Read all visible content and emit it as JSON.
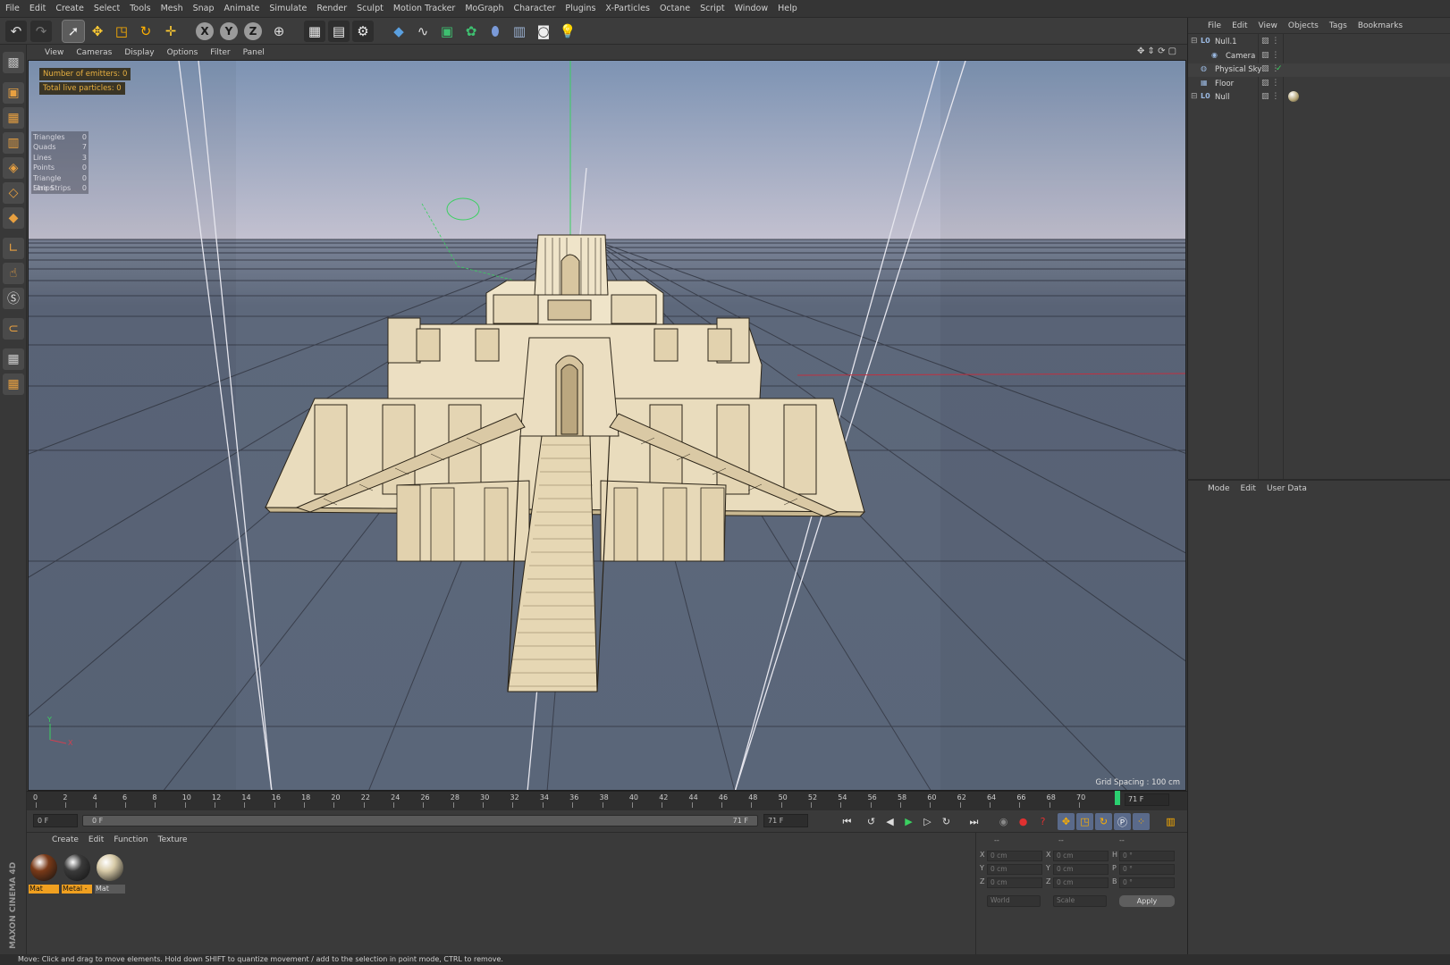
{
  "menu": [
    "File",
    "Edit",
    "Create",
    "Select",
    "Tools",
    "Mesh",
    "Snap",
    "Animate",
    "Simulate",
    "Render",
    "Sculpt",
    "Motion Tracker",
    "MoGraph",
    "Character",
    "Plugins",
    "X-Particles",
    "Octane",
    "Script",
    "Window",
    "Help"
  ],
  "toolbar": {
    "icons": [
      "undo-icon",
      "redo-icon",
      "select-tool-icon",
      "move-tool-icon",
      "scale-tool-icon",
      "rotate-tool-icon",
      "live-select-icon",
      "x-axis-lock-icon",
      "y-axis-lock-icon",
      "z-axis-lock-icon",
      "coordinate-system-icon",
      "render-view-icon",
      "render-picture-viewer-icon",
      "render-settings-icon",
      "cube-primitive-icon",
      "spline-pen-icon",
      "subdivision-surface-icon",
      "cloner-icon",
      "deformer-icon",
      "floor-scene-icon",
      "camera-icon",
      "light-icon"
    ],
    "axis_labels": [
      "X",
      "Y",
      "Z"
    ]
  },
  "left_tools": [
    "make-editable-icon",
    "model-mode-icon",
    "texture-mode-icon",
    "workplane-icon",
    "points-mode-icon",
    "edges-mode-icon",
    "polygons-mode-icon",
    "axis-mode-icon",
    "tweak-mode-icon",
    "solo-mode-icon",
    "snap-icon",
    "workplane-lock-icon",
    "quantize-icon"
  ],
  "viewport": {
    "menu": [
      "View",
      "Cameras",
      "Display",
      "Options",
      "Filter",
      "Panel"
    ],
    "emitters_label": "Number of emitters: 0",
    "particles_label": "Total live particles: 0",
    "stats": [
      {
        "label": "Triangles",
        "value": "0"
      },
      {
        "label": "Quads",
        "value": "7"
      },
      {
        "label": "Lines",
        "value": "3"
      },
      {
        "label": "Points",
        "value": "0"
      },
      {
        "label": "Triangle Strips",
        "value": "0"
      },
      {
        "label": "Line Strips",
        "value": "0"
      }
    ],
    "grid_spacing": "Grid Spacing : 100 cm",
    "colors": {
      "sky_top": "#7d93b3",
      "sky_bottom": "#c3c1d0",
      "floor": "#5b677b",
      "grid": "#2a2f39",
      "model": "#efe2c6",
      "model_shade": "#d9c7a3"
    }
  },
  "timeline": {
    "ticks": [
      "0",
      "2",
      "4",
      "6",
      "8",
      "10",
      "12",
      "14",
      "16",
      "18",
      "20",
      "22",
      "24",
      "26",
      "28",
      "30",
      "32",
      "34",
      "36",
      "38",
      "40",
      "42",
      "44",
      "46",
      "48",
      "50",
      "52",
      "54",
      "56",
      "58",
      "60",
      "62",
      "64",
      "66",
      "68",
      "70"
    ],
    "current_frame": "71 F",
    "start_field": "0 F",
    "range_start": "0 F",
    "range_end": "71 F",
    "end_field": "71 F"
  },
  "transport": [
    "go-to-start-icon",
    "previous-key-icon",
    "play-reverse-icon",
    "play-forward-icon",
    "next-key-icon",
    "loop-icon",
    "go-to-end-icon",
    "record-icon",
    "auto-key-icon",
    "keyframe-help-icon",
    "key-position-icon",
    "key-scale-icon",
    "key-rotation-icon",
    "key-parameter-icon",
    "key-pla-icon",
    "timeline-window-icon"
  ],
  "materials": {
    "menu": [
      "Create",
      "Edit",
      "Function",
      "Texture"
    ],
    "items": [
      {
        "label": "Mat",
        "color": "#7a3a18"
      },
      {
        "label": "Metal -",
        "color": "#3a3a3a"
      },
      {
        "label": "Mat",
        "color": "#d8cba8"
      }
    ]
  },
  "coords": {
    "headers": [
      "--",
      "--",
      "--"
    ],
    "rows": [
      {
        "a": "X",
        "av": "0 cm",
        "b": "X",
        "bv": "0 cm",
        "c": "H",
        "cv": "0 °"
      },
      {
        "a": "Y",
        "av": "0 cm",
        "b": "Y",
        "bv": "0 cm",
        "c": "P",
        "cv": "0 °"
      },
      {
        "a": "Z",
        "av": "0 cm",
        "b": "Z",
        "bv": "0 cm",
        "c": "B",
        "cv": "0 °"
      }
    ],
    "world": "World",
    "scale": "Scale",
    "apply": "Apply"
  },
  "objects": {
    "menu": [
      "File",
      "Edit",
      "View",
      "Objects",
      "Tags",
      "Bookmarks"
    ],
    "items": [
      {
        "name": "Null.1",
        "indent": 0,
        "icon": "null-object-icon"
      },
      {
        "name": "Camera",
        "indent": 1,
        "icon": "camera-object-icon"
      },
      {
        "name": "Physical Sky",
        "indent": 0,
        "icon": "sky-object-icon"
      },
      {
        "name": "Floor",
        "indent": 0,
        "icon": "floor-object-icon"
      },
      {
        "name": "Null",
        "indent": 0,
        "icon": "null-object-icon"
      }
    ]
  },
  "attributes": {
    "menu": [
      "Mode",
      "Edit",
      "User Data"
    ]
  },
  "status": "Move: Click and drag to move elements. Hold down SHIFT to quantize movement / add to the selection in point mode, CTRL to remove.",
  "brand": "MAXON CINEMA 4D"
}
